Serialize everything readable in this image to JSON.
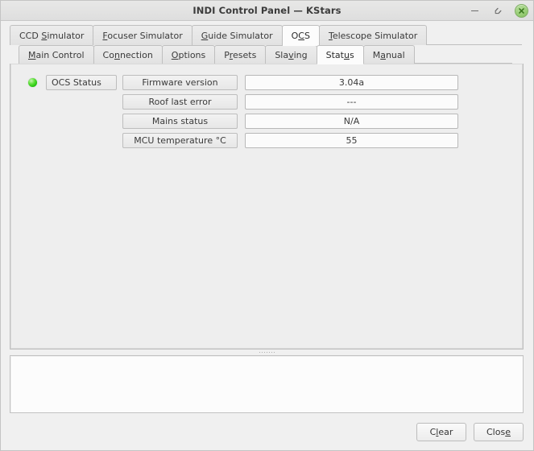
{
  "window": {
    "title": "INDI Control Panel — KStars",
    "controls": {
      "minimize": "minimize-icon",
      "maximize": "maximize-icon",
      "close": "close-icon"
    },
    "accent_green": "#8fc96c"
  },
  "device_tabs": [
    {
      "label": "CCD Simulator",
      "mnemonic_index": 4,
      "active": false
    },
    {
      "label": "Focuser Simulator",
      "mnemonic_index": 0,
      "active": false
    },
    {
      "label": "Guide Simulator",
      "mnemonic_index": 0,
      "active": false
    },
    {
      "label": "OCS",
      "mnemonic_index": 1,
      "active": true
    },
    {
      "label": "Telescope Simulator",
      "mnemonic_index": 0,
      "active": false
    }
  ],
  "section_tabs": [
    {
      "label": "Main Control",
      "mnemonic_index": 0,
      "active": false
    },
    {
      "label": "Connection",
      "mnemonic_index": 2,
      "active": false
    },
    {
      "label": "Options",
      "mnemonic_index": 0,
      "active": false
    },
    {
      "label": "Presets",
      "mnemonic_index": 1,
      "active": false
    },
    {
      "label": "Slaving",
      "mnemonic_index": 3,
      "active": false
    },
    {
      "label": "Status",
      "mnemonic_index": 4,
      "active": true
    },
    {
      "label": "Manual",
      "mnemonic_index": 1,
      "active": false
    }
  ],
  "properties": [
    {
      "led": "green",
      "group": "OCS Status",
      "label": "Firmware version",
      "value": "3.04a"
    },
    {
      "led": "none",
      "group": "",
      "label": "Roof last error",
      "value": "---"
    },
    {
      "led": "none",
      "group": "",
      "label": "Mains status",
      "value": "N/A"
    },
    {
      "led": "none",
      "group": "",
      "label": "MCU temperature °C",
      "value": "55"
    }
  ],
  "log": {
    "content": ""
  },
  "buttons": {
    "clear": {
      "label": "Clear",
      "mnemonic_index": 2
    },
    "close": {
      "label": "Close",
      "mnemonic_index": 3
    }
  }
}
